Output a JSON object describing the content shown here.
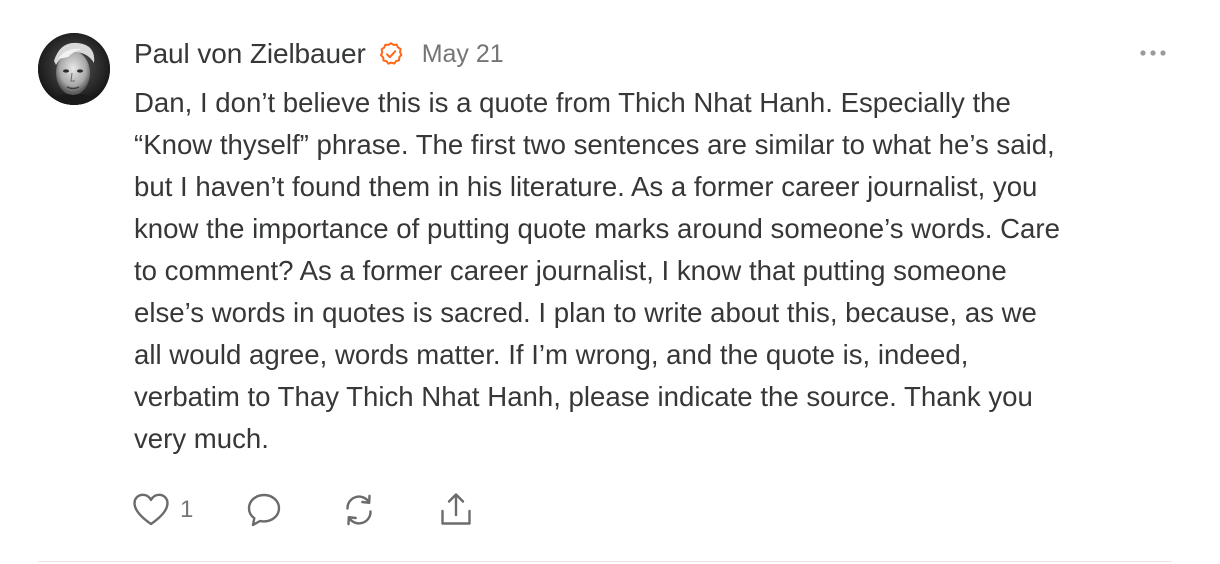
{
  "comment": {
    "author": "Paul von Zielbauer",
    "date": "May 21",
    "body": "Dan, I don’t believe this is a quote from Thich Nhat Hanh. Especially the\n“Know thyself” phrase. The first two sentences are similar to what he’s said,\nbut I haven’t found them in his literature. As a former career journalist, you\nknow the importance of putting quote marks around someone’s words. Care\nto comment? As a former career journalist, I know that putting someone\nelse’s words in quotes is sacred. I plan to write about this, because, as we\nall would agree, words matter. If I’m wrong, and the quote is, indeed,\nverbatim to Thay Thich Nhat Hanh, please indicate the source. Thank you\nvery much.",
    "like_count": "1"
  },
  "icons": {
    "verified": "verified-badge-icon",
    "more": "more-horizontal-icon",
    "like": "heart-icon",
    "reply": "comment-bubble-icon",
    "restack": "restack-icon",
    "share": "share-icon"
  },
  "colors": {
    "accent": "#FF6719",
    "text": "#363737",
    "muted": "#757575",
    "icon": "#6B6B6B",
    "divider": "#E6E6E6"
  }
}
